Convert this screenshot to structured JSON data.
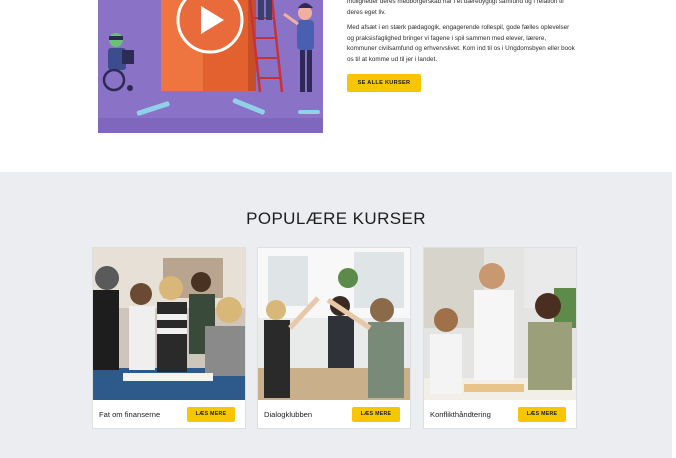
{
  "intro": {
    "paragraph_1": "muligheder deres medborgerskab har i et bæredygtigt samfund og i relation til deres eget liv.",
    "paragraph_2": "Med afsæt i en stærk pædagogik, engagerende rollespil, gode fælles oplevelser og praksisfaglighed bringer vi fagene i spil sammen med elever, lærere, kommuner civilsamfund og erhvervslivet. Kom ind til os i Ungdomsbyen eller book os til at komme ud til jer i landet.",
    "cta_label": "SE ALLE KURSER"
  },
  "video": {
    "play_icon": "play-icon"
  },
  "courses": {
    "title": "POPULÆRE KURSER",
    "cards": [
      {
        "name": "Fat om finanserne",
        "button": "LÆS MERE"
      },
      {
        "name": "Dialogklubben",
        "button": "LÆS MERE"
      },
      {
        "name": "Konflikthåndtering",
        "button": "LÆS MERE"
      }
    ]
  },
  "colors": {
    "accent_yellow": "#f7c600",
    "video_purple": "#8a72c6",
    "section_gray": "#ebedf0"
  }
}
